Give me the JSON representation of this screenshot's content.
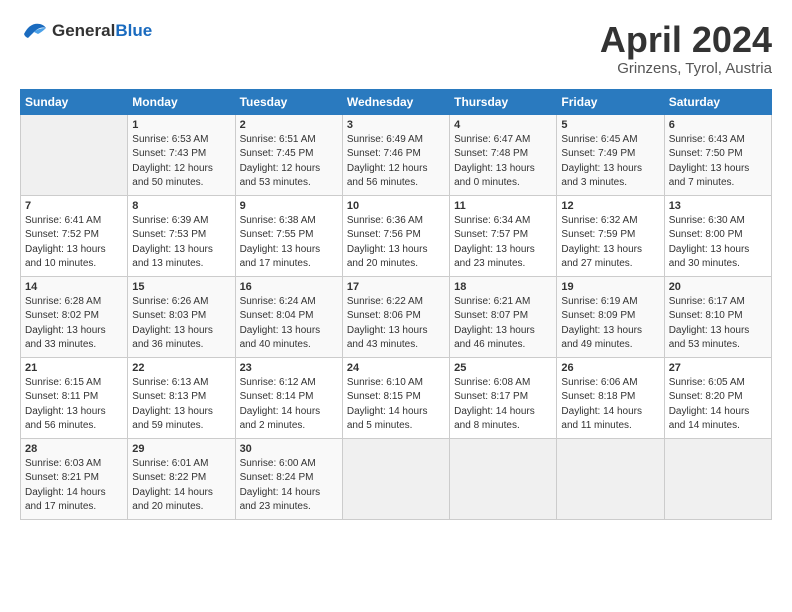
{
  "logo": {
    "general": "General",
    "blue": "Blue"
  },
  "title": "April 2024",
  "location": "Grinzens, Tyrol, Austria",
  "days_header": [
    "Sunday",
    "Monday",
    "Tuesday",
    "Wednesday",
    "Thursday",
    "Friday",
    "Saturday"
  ],
  "weeks": [
    [
      {
        "num": "",
        "info": ""
      },
      {
        "num": "1",
        "info": "Sunrise: 6:53 AM\nSunset: 7:43 PM\nDaylight: 12 hours\nand 50 minutes."
      },
      {
        "num": "2",
        "info": "Sunrise: 6:51 AM\nSunset: 7:45 PM\nDaylight: 12 hours\nand 53 minutes."
      },
      {
        "num": "3",
        "info": "Sunrise: 6:49 AM\nSunset: 7:46 PM\nDaylight: 12 hours\nand 56 minutes."
      },
      {
        "num": "4",
        "info": "Sunrise: 6:47 AM\nSunset: 7:48 PM\nDaylight: 13 hours\nand 0 minutes."
      },
      {
        "num": "5",
        "info": "Sunrise: 6:45 AM\nSunset: 7:49 PM\nDaylight: 13 hours\nand 3 minutes."
      },
      {
        "num": "6",
        "info": "Sunrise: 6:43 AM\nSunset: 7:50 PM\nDaylight: 13 hours\nand 7 minutes."
      }
    ],
    [
      {
        "num": "7",
        "info": "Sunrise: 6:41 AM\nSunset: 7:52 PM\nDaylight: 13 hours\nand 10 minutes."
      },
      {
        "num": "8",
        "info": "Sunrise: 6:39 AM\nSunset: 7:53 PM\nDaylight: 13 hours\nand 13 minutes."
      },
      {
        "num": "9",
        "info": "Sunrise: 6:38 AM\nSunset: 7:55 PM\nDaylight: 13 hours\nand 17 minutes."
      },
      {
        "num": "10",
        "info": "Sunrise: 6:36 AM\nSunset: 7:56 PM\nDaylight: 13 hours\nand 20 minutes."
      },
      {
        "num": "11",
        "info": "Sunrise: 6:34 AM\nSunset: 7:57 PM\nDaylight: 13 hours\nand 23 minutes."
      },
      {
        "num": "12",
        "info": "Sunrise: 6:32 AM\nSunset: 7:59 PM\nDaylight: 13 hours\nand 27 minutes."
      },
      {
        "num": "13",
        "info": "Sunrise: 6:30 AM\nSunset: 8:00 PM\nDaylight: 13 hours\nand 30 minutes."
      }
    ],
    [
      {
        "num": "14",
        "info": "Sunrise: 6:28 AM\nSunset: 8:02 PM\nDaylight: 13 hours\nand 33 minutes."
      },
      {
        "num": "15",
        "info": "Sunrise: 6:26 AM\nSunset: 8:03 PM\nDaylight: 13 hours\nand 36 minutes."
      },
      {
        "num": "16",
        "info": "Sunrise: 6:24 AM\nSunset: 8:04 PM\nDaylight: 13 hours\nand 40 minutes."
      },
      {
        "num": "17",
        "info": "Sunrise: 6:22 AM\nSunset: 8:06 PM\nDaylight: 13 hours\nand 43 minutes."
      },
      {
        "num": "18",
        "info": "Sunrise: 6:21 AM\nSunset: 8:07 PM\nDaylight: 13 hours\nand 46 minutes."
      },
      {
        "num": "19",
        "info": "Sunrise: 6:19 AM\nSunset: 8:09 PM\nDaylight: 13 hours\nand 49 minutes."
      },
      {
        "num": "20",
        "info": "Sunrise: 6:17 AM\nSunset: 8:10 PM\nDaylight: 13 hours\nand 53 minutes."
      }
    ],
    [
      {
        "num": "21",
        "info": "Sunrise: 6:15 AM\nSunset: 8:11 PM\nDaylight: 13 hours\nand 56 minutes."
      },
      {
        "num": "22",
        "info": "Sunrise: 6:13 AM\nSunset: 8:13 PM\nDaylight: 13 hours\nand 59 minutes."
      },
      {
        "num": "23",
        "info": "Sunrise: 6:12 AM\nSunset: 8:14 PM\nDaylight: 14 hours\nand 2 minutes."
      },
      {
        "num": "24",
        "info": "Sunrise: 6:10 AM\nSunset: 8:15 PM\nDaylight: 14 hours\nand 5 minutes."
      },
      {
        "num": "25",
        "info": "Sunrise: 6:08 AM\nSunset: 8:17 PM\nDaylight: 14 hours\nand 8 minutes."
      },
      {
        "num": "26",
        "info": "Sunrise: 6:06 AM\nSunset: 8:18 PM\nDaylight: 14 hours\nand 11 minutes."
      },
      {
        "num": "27",
        "info": "Sunrise: 6:05 AM\nSunset: 8:20 PM\nDaylight: 14 hours\nand 14 minutes."
      }
    ],
    [
      {
        "num": "28",
        "info": "Sunrise: 6:03 AM\nSunset: 8:21 PM\nDaylight: 14 hours\nand 17 minutes."
      },
      {
        "num": "29",
        "info": "Sunrise: 6:01 AM\nSunset: 8:22 PM\nDaylight: 14 hours\nand 20 minutes."
      },
      {
        "num": "30",
        "info": "Sunrise: 6:00 AM\nSunset: 8:24 PM\nDaylight: 14 hours\nand 23 minutes."
      },
      {
        "num": "",
        "info": ""
      },
      {
        "num": "",
        "info": ""
      },
      {
        "num": "",
        "info": ""
      },
      {
        "num": "",
        "info": ""
      }
    ]
  ]
}
